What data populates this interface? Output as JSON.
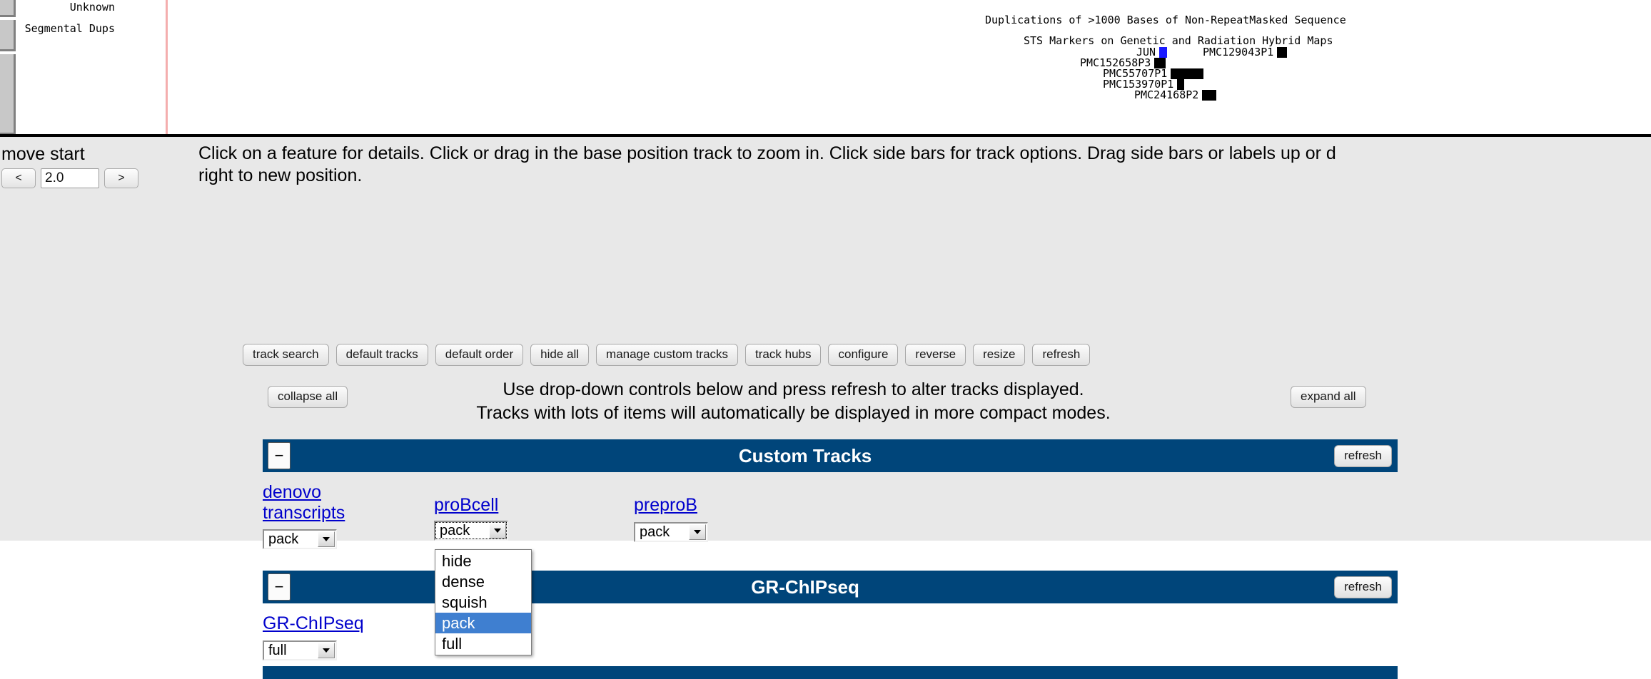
{
  "browser_image": {
    "left_labels": [
      {
        "name": "unknown",
        "text": "Unknown"
      },
      {
        "name": "segmental-dups",
        "text": "Segmental Dups"
      }
    ],
    "center_titles": {
      "duplications": "Duplications of >1000 Bases of Non-RepeatMasked Sequence",
      "sts_markers": "STS Markers on Genetic and Radiation Hybrid Maps"
    },
    "markers": [
      {
        "label": "JUN",
        "block_width": 11,
        "color": "#1a1aff"
      },
      {
        "label": "PMC129043P1",
        "block_width": 14,
        "color": "#000000"
      },
      {
        "label": "PMC152658P3",
        "block_width": 16,
        "color": "#000000"
      },
      {
        "label": "PMC55707P1",
        "block_width": 46,
        "color": "#000000"
      },
      {
        "label": "PMC153970P1",
        "block_width": 10,
        "color": "#000000"
      },
      {
        "label": "PMC24168P2",
        "block_width": 20,
        "color": "#000000"
      }
    ]
  },
  "navigation": {
    "move_start_label": "move start",
    "left_arrow": "<",
    "right_arrow": ">",
    "amount_value": "2.0"
  },
  "instructions": {
    "line1": "Click on a feature for details. Click or drag in the base position track to zoom in. Click side bars for track options. Drag side bars or labels up or d",
    "line2": "right to new position."
  },
  "toolbar": {
    "buttons": [
      {
        "name": "track-search",
        "label": "track search"
      },
      {
        "name": "default-tracks",
        "label": "default tracks"
      },
      {
        "name": "default-order",
        "label": "default order"
      },
      {
        "name": "hide-all",
        "label": "hide all"
      },
      {
        "name": "manage-custom-tracks",
        "label": "manage custom tracks"
      },
      {
        "name": "track-hubs",
        "label": "track hubs"
      },
      {
        "name": "configure",
        "label": "configure"
      },
      {
        "name": "reverse",
        "label": "reverse"
      },
      {
        "name": "resize",
        "label": "resize"
      },
      {
        "name": "refresh",
        "label": "refresh"
      }
    ],
    "collapse_all": "collapse all",
    "expand_all": "expand all",
    "help_line1": "Use drop-down controls below and press refresh to alter tracks displayed.",
    "help_line2": "Tracks with lots of items will automatically be displayed in more compact modes."
  },
  "groups": {
    "custom_tracks": {
      "title": "Custom Tracks",
      "toggle": "−",
      "refresh": "refresh"
    },
    "grchipseq": {
      "title": "GR-ChIPseq",
      "toggle": "−",
      "refresh": "refresh"
    }
  },
  "tracks": [
    {
      "name": "denovo-transcripts",
      "link_line1": "denovo",
      "link_line2": "transcripts",
      "mode": "pack"
    },
    {
      "name": "probcell",
      "link": "proBcell",
      "mode": "pack"
    },
    {
      "name": "preprob",
      "link": "preproB",
      "mode": "pack"
    },
    {
      "name": "grchipseq",
      "link": "GR-ChIPseq",
      "mode": "full"
    }
  ],
  "open_dropdown": {
    "owner": "probcell",
    "options": [
      "hide",
      "dense",
      "squish",
      "pack",
      "full"
    ],
    "selected": "pack",
    "highlight_color": "#3f7fd0"
  },
  "colors": {
    "group_header_blue": "#00457a",
    "link_blue": "#0000cc",
    "page_background": "#e8e8e8",
    "separator_pink": "#f4aeae"
  }
}
